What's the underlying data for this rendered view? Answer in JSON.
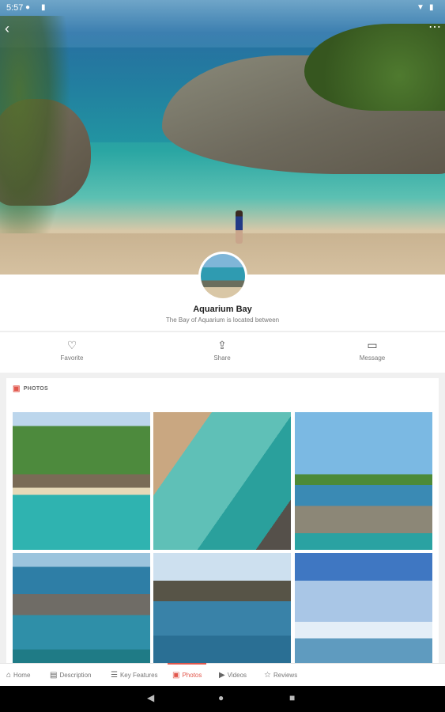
{
  "status_bar": {
    "time": "5:57",
    "icons": [
      "app-icon",
      "clipboard-icon",
      "wifi-icon",
      "battery-icon"
    ]
  },
  "header": {
    "back_icon": "back-arrow-icon",
    "more_icon": "more-dots-icon"
  },
  "place": {
    "title": "Aquarium Bay",
    "subtitle": "The Bay of Aquarium is located between"
  },
  "actions": [
    {
      "label": "Favorite",
      "icon": "heart-icon",
      "glyph": "♡"
    },
    {
      "label": "Share",
      "icon": "share-icon",
      "glyph": "⇪"
    },
    {
      "label": "Message",
      "icon": "message-icon",
      "glyph": "▭"
    }
  ],
  "photos": {
    "heading": "PHOTOS",
    "icon": "photo-icon",
    "glyph": "▣",
    "count": 6
  },
  "tabs": [
    {
      "label": "Home",
      "icon": "home-icon",
      "glyph": "⌂"
    },
    {
      "label": "Description",
      "icon": "document-icon",
      "glyph": "▤"
    },
    {
      "label": "Key Features",
      "icon": "list-icon",
      "glyph": "☰"
    },
    {
      "label": "Photos",
      "icon": "photo-icon",
      "glyph": "▣",
      "active": true
    },
    {
      "label": "Videos",
      "icon": "video-icon",
      "glyph": "▶"
    },
    {
      "label": "Reviews",
      "icon": "star-icon",
      "glyph": "☆"
    }
  ],
  "colors": {
    "accent": "#e2574c"
  }
}
